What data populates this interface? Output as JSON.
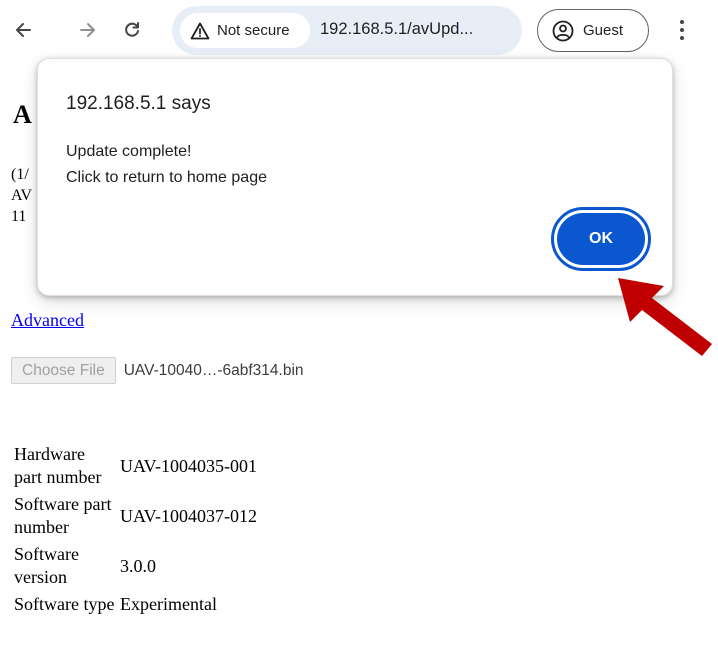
{
  "browser": {
    "security_label": "Not secure",
    "url": "192.168.5.1/avUpd...",
    "profile_label": "Guest"
  },
  "page": {
    "heading_visible": "A",
    "info_lines": [
      "(1/",
      "AV",
      "11"
    ],
    "advanced_link": "Advanced",
    "file_button": "Choose File",
    "file_name": "UAV-10040…-6abf314.bin",
    "table": [
      {
        "label": "Hardware part number",
        "value": "UAV-1004035-001"
      },
      {
        "label": "Software part number",
        "value": "UAV-1004037-012"
      },
      {
        "label": "Software version",
        "value": "3.0.0"
      },
      {
        "label": "Software type",
        "value": "Experimental"
      }
    ]
  },
  "dialog": {
    "title": "192.168.5.1 says",
    "message_line1": "Update complete!",
    "message_line2": "Click to return to home page",
    "ok_label": "OK"
  },
  "colors": {
    "accent": "#0b57d0",
    "omnibox": "#e8eef8",
    "arrow": "#c00000"
  }
}
